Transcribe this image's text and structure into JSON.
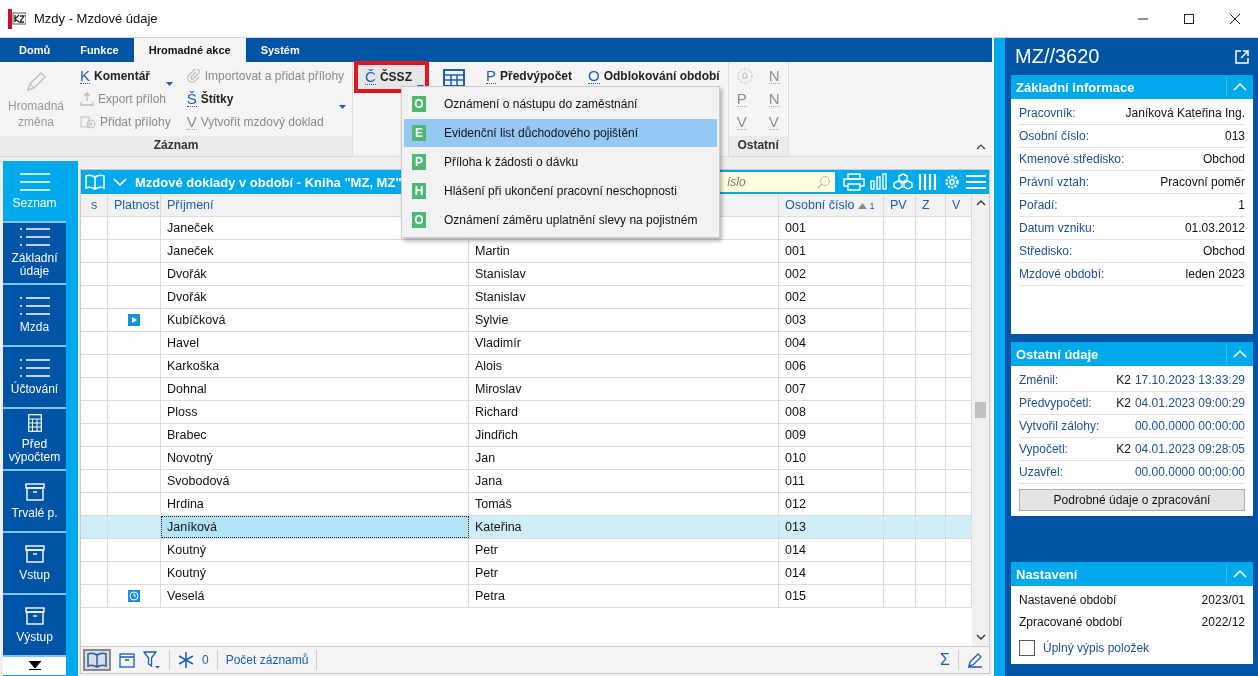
{
  "window": {
    "title": "Mzdy - Mzdové údaje"
  },
  "tabs": [
    {
      "label": "Domů",
      "selected": false
    },
    {
      "label": "Funkce",
      "selected": false
    },
    {
      "label": "Hromadné akce",
      "selected": true
    },
    {
      "label": "Systém",
      "selected": false
    }
  ],
  "ribbon": {
    "groups": [
      {
        "label": "Záznam",
        "columns": [
          [
            {
              "kind": "large",
              "label": "Hromadná změna",
              "disabled": true
            }
          ],
          [
            {
              "kind": "letter",
              "key": "K",
              "label": "Komentář",
              "dropdown": true,
              "disabled": false
            },
            {
              "kind": "export",
              "label": "Export příloh",
              "disabled": true
            },
            {
              "kind": "attach",
              "label": "Přidat přílohy",
              "disabled": true
            }
          ],
          [
            {
              "kind": "paperclip",
              "label": "Importovat a přidat přílohy",
              "disabled": true
            },
            {
              "kind": "letter",
              "key": "Š",
              "label": "Štítky",
              "dropdown": true,
              "disabled": false
            },
            {
              "kind": "letter",
              "key": "V",
              "label": "Vytvořit mzdový doklad",
              "disabled": true
            }
          ]
        ]
      },
      {
        "columns": [
          [
            {
              "kind": "letter",
              "key": "Č",
              "label": "ČSSZ",
              "dropdown": true,
              "disabled": false,
              "highlighted": true
            }
          ],
          [
            {
              "kind": "table",
              "disabled": false
            }
          ],
          [
            {
              "kind": "letter",
              "key": "P",
              "label": "Předvýpočet",
              "disabled": false
            }
          ],
          [
            {
              "kind": "letter",
              "key": "O",
              "label": "Odblokování období",
              "disabled": false
            }
          ]
        ]
      },
      {
        "label": "Ostatní",
        "columns": [
          [
            {
              "kind": "bell",
              "disabled": true
            },
            {
              "kind": "letter",
              "key": "P",
              "disabled": true
            },
            {
              "kind": "letter",
              "key": "V",
              "disabled": true
            }
          ],
          [
            {
              "kind": "letter",
              "key": "N",
              "disabled": true
            },
            {
              "kind": "letter",
              "key": "N",
              "disabled": true
            },
            {
              "kind": "letter",
              "key": "V",
              "disabled": true
            }
          ]
        ]
      }
    ]
  },
  "menu": {
    "items": [
      {
        "key": "O",
        "label": "Oznámení o nástupu do zaměstnání",
        "selected": false
      },
      {
        "key": "E",
        "label": "Evidenční list důchodového pojištění",
        "selected": true
      },
      {
        "key": "P",
        "label": "Příloha k žádosti o dávku",
        "selected": false
      },
      {
        "key": "H",
        "label": "Hlášení při ukončení pracovní neschopnosti",
        "selected": false
      },
      {
        "key": "O",
        "label": "Oznámení záměru uplatnění slevy na pojistném",
        "selected": false
      }
    ]
  },
  "nav": {
    "items": [
      {
        "kind": "list",
        "label": "Seznam",
        "selected": true
      },
      {
        "kind": "list",
        "label": "Základní údaje",
        "selected": false
      },
      {
        "kind": "list",
        "label": "Mzda",
        "selected": false
      },
      {
        "kind": "list",
        "label": "Účtování",
        "selected": false
      },
      {
        "kind": "calculator",
        "label": "Před výpočtem",
        "selected": false
      },
      {
        "kind": "box",
        "label": "Trvalé p.",
        "selected": false
      },
      {
        "kind": "box",
        "label": "Vstup",
        "selected": false
      },
      {
        "kind": "box",
        "label": "Výstup",
        "selected": false
      }
    ]
  },
  "grid": {
    "title": "Mzdové doklady v období - Kniha \"MZ, MZ\"",
    "search": {
      "placeholder": "íslo"
    },
    "columns": [
      {
        "label": "s"
      },
      {
        "label": "Platnost"
      },
      {
        "label": "Příjmení"
      },
      {},
      {
        "label": "Osobní číslo",
        "sorted_ascending": true,
        "sort_index": "1"
      },
      {
        "label": "PV"
      },
      {
        "label": "Z"
      },
      {
        "label": "V"
      }
    ],
    "rows": [
      {
        "surname": "Janeček",
        "number": "001",
        "selected": false
      },
      {
        "surname": "Janeček",
        "column_4": "Martin",
        "number": "001",
        "selected": false
      },
      {
        "surname": "Dvořák",
        "column_4": "Stanislav",
        "number": "002",
        "selected": false
      },
      {
        "surname": "Dvořák",
        "column_4": "Stanislav",
        "number": "002",
        "selected": false
      },
      {
        "kind": "play",
        "surname": "Kubíčková",
        "column_4": "Sylvie",
        "number": "003",
        "selected": false
      },
      {
        "surname": "Havel",
        "column_4": "Vladimír",
        "number": "004",
        "selected": false
      },
      {
        "surname": "Karkoška",
        "column_4": "Alois",
        "number": "006",
        "selected": false
      },
      {
        "surname": "Dohnal",
        "column_4": "Miroslav",
        "number": "007",
        "selected": false
      },
      {
        "surname": "Ploss",
        "column_4": "Richard",
        "number": "008",
        "selected": false
      },
      {
        "surname": "Brabec",
        "column_4": "Jindřich",
        "number": "009",
        "selected": false
      },
      {
        "surname": "Novotný",
        "column_4": "Jan",
        "number": "010",
        "selected": false
      },
      {
        "surname": "Svobodová",
        "column_4": "Jana",
        "number": "011",
        "selected": false
      },
      {
        "surname": "Hrdina",
        "column_4": "Tomáš",
        "number": "012",
        "selected": false
      },
      {
        "surname": "Janíková",
        "column_4": "Kateřina",
        "number": "013",
        "selected": true
      },
      {
        "surname": "Koutný",
        "column_4": "Petr",
        "number": "014",
        "selected": false
      },
      {
        "surname": "Koutný",
        "column_4": "Petr",
        "number": "014",
        "selected": false
      },
      {
        "kind": "clock",
        "surname": "Veselá",
        "column_4": "Petra",
        "number": "015",
        "selected": false
      }
    ],
    "footer": {
      "count": "0",
      "link": "Počet záznamů",
      "sum": "Σ"
    }
  },
  "panel": {
    "title": "MZ//3620",
    "sections": [
      {
        "title": "Základní informace",
        "expanded": true,
        "kind": "info",
        "rows": [
          {
            "label": "Pracovník:",
            "value": "Janíková Kateřina Ing."
          },
          {
            "label": "Osobní číslo:",
            "value": "013"
          },
          {
            "label": "Kmenové středisko:",
            "value": "Obchod"
          },
          {
            "label": "Právní vztah:",
            "value": "Pracovní poměr"
          },
          {
            "label": "Pořadí:",
            "value": "1"
          },
          {
            "label": "Datum vzniku:",
            "value": "01.03.2012"
          },
          {
            "label": "Středisko:",
            "value": "Obchod"
          },
          {
            "label": "Mzdové období:",
            "value": "leden 2023"
          }
        ]
      },
      {
        "title": "Ostatní údaje",
        "expanded": true,
        "kind": "audit",
        "rows": [
          {
            "label": "Změnil:",
            "user": "K2",
            "value": "17.10.2023 13:33:29"
          },
          {
            "label": "Předvypočetl:",
            "user": "K2",
            "value": "04.01.2023 09:00:29"
          },
          {
            "label": "Vytvořil zálohy:",
            "value": "00.00.0000 00:00:00"
          },
          {
            "label": "Vypočetl:",
            "user": "K2",
            "value": "04.01.2023 09:28:05"
          },
          {
            "label": "Uzavřel:",
            "value": "00.00.0000 00:00:00"
          }
        ],
        "button": "Podrobné údaje o zpracování"
      },
      {
        "title": "Nastavení",
        "expanded": true,
        "kind": "settings",
        "rows": [
          {
            "label": "Nastavené období",
            "value": "2023/01"
          },
          {
            "label": "Zpracované období",
            "value": "2022/12"
          }
        ],
        "checkbox": {
          "label": "Úplný výpis položek",
          "checked": false
        }
      }
    ]
  }
}
